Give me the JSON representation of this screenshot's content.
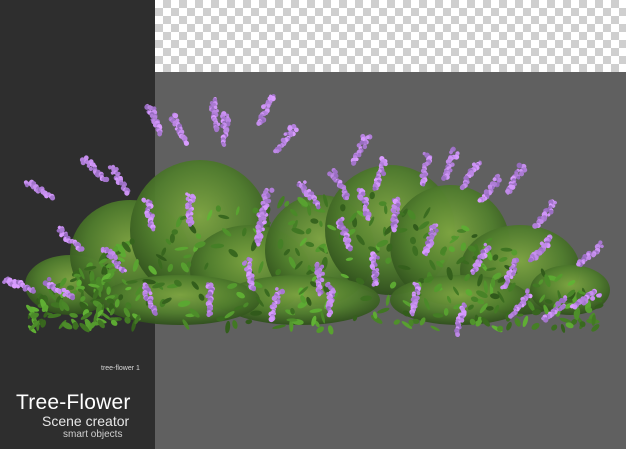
{
  "image_caption": "tree-flower 1",
  "title": "Tree-Flower",
  "subtitle": "Scene creator",
  "tagline": "smart objects",
  "colors": {
    "dark_panel": "#2e2e2e",
    "gray_panel": "#606060",
    "leaf_dark": "#3f6a25",
    "leaf_light": "#7fa642",
    "flower": "#b08ad8"
  }
}
